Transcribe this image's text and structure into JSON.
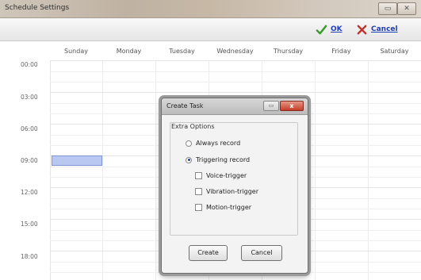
{
  "window": {
    "title": "Schedule Settings",
    "restore_glyph": "▭",
    "close_glyph": "✕"
  },
  "toolbar": {
    "ok_label": "OK",
    "cancel_label": "Cancel",
    "ok_icon": "check-icon",
    "cancel_icon": "x-icon"
  },
  "schedule": {
    "days": [
      "Sunday",
      "Monday",
      "Tuesday",
      "Wednesday",
      "Thursday",
      "Friday",
      "Saturday"
    ],
    "times": [
      "00:00",
      "03:00",
      "06:00",
      "09:00",
      "12:00",
      "15:00",
      "18:00"
    ],
    "selected_slot": {
      "day": "Sunday",
      "time": "09:00"
    }
  },
  "dialog": {
    "title": "Create Task",
    "restore_glyph": "▭",
    "close_glyph": "x",
    "group_title": "Extra Options",
    "options": {
      "always_record": "Always record",
      "triggering_record": "Triggering record"
    },
    "selected_option": "Triggering record",
    "triggers": {
      "voice": "Voice-trigger",
      "vibration": "Vibration-trigger",
      "motion": "Motion-trigger"
    },
    "create_label": "Create",
    "cancel_label": "Cancel"
  },
  "colors": {
    "link_blue": "#1f3fb8",
    "selection_fill": "#b9c8f0",
    "ok_green": "#3a9a2c",
    "cancel_red": "#c3302a"
  }
}
